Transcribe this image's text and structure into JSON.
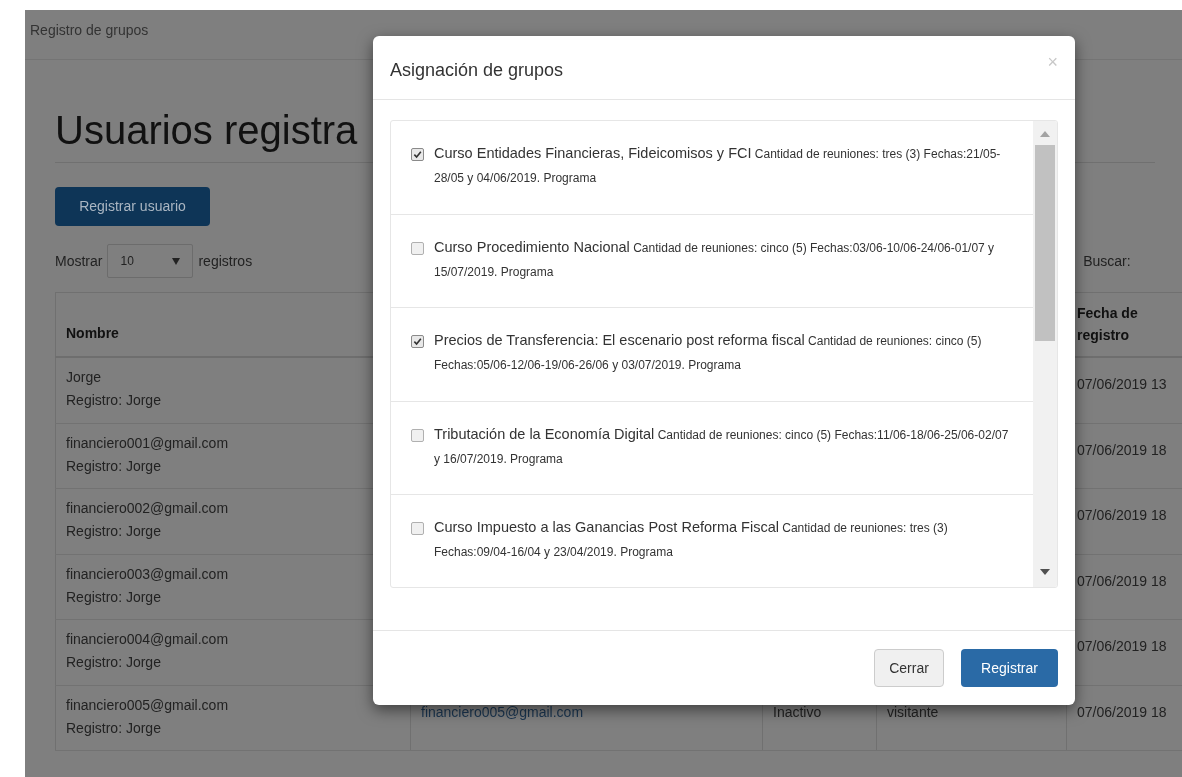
{
  "navbar": {
    "title": "Registro de grupos"
  },
  "page": {
    "heading": "Usuarios registra",
    "register_button": "Registrar usuario",
    "length": {
      "prefix": "Mostrar",
      "value": "10",
      "suffix": "registros"
    },
    "search_label": "Buscar:"
  },
  "table": {
    "columns": [
      {
        "label": "Nombre"
      },
      {
        "label": "Fecha de\nregistro"
      }
    ],
    "rows": [
      {
        "name": "Jorge",
        "registered_by": "Registro: Jorge",
        "date": "07/06/2019 13"
      },
      {
        "name": "financiero001@gmail.com",
        "registered_by": "Registro: Jorge",
        "date": "07/06/2019 18"
      },
      {
        "name": "financiero002@gmail.com",
        "registered_by": "Registro: Jorge",
        "date": "07/06/2019 18"
      },
      {
        "name": "financiero003@gmail.com",
        "registered_by": "Registro: Jorge",
        "date": "07/06/2019 18"
      },
      {
        "name": "financiero004@gmail.com",
        "registered_by": "Registro: Jorge",
        "date": "07/06/2019 18"
      },
      {
        "name": "financiero005@gmail.com",
        "registered_by": "Registro: Jorge",
        "email": "financiero005@gmail.com",
        "status": "Inactivo",
        "role": "visitante",
        "date": "07/06/2019 18"
      }
    ]
  },
  "modal": {
    "title": "Asignación de grupos",
    "close": "×",
    "groups": [
      {
        "title": "Curso Entidades Financieras, Fideicomisos y FCI",
        "details": "Cantidad de reuniones: tres (3) Fechas:21/05-28/05 y 04/06/2019. Programa",
        "checked": true
      },
      {
        "title": "Curso Procedimiento Nacional",
        "details": "Cantidad de reuniones: cinco (5) Fechas:03/06-10/06-24/06-01/07 y 15/07/2019. Programa",
        "checked": false
      },
      {
        "title": "Precios de Transferencia: El escenario post reforma fiscal",
        "details": "Cantidad de reuniones: cinco (5) Fechas:05/06-12/06-19/06-26/06 y 03/07/2019. Programa",
        "checked": true
      },
      {
        "title": "Tributación de la Economía Digital",
        "details": "Cantidad de reuniones: cinco (5) Fechas:11/06-18/06-25/06-02/07 y 16/07/2019. Programa",
        "checked": false
      },
      {
        "title": "Curso Impuesto a las Ganancias Post Reforma Fiscal",
        "details": "Cantidad de reuniones: tres (3) Fechas:09/04-16/04 y 23/04/2019. Programa",
        "checked": false
      }
    ],
    "buttons": {
      "cancel": "Cerrar",
      "submit": "Registrar"
    }
  }
}
